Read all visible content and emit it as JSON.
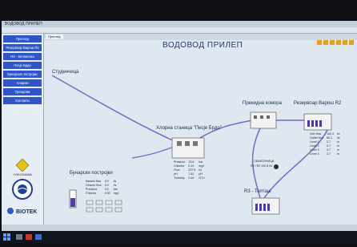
{
  "window": {
    "title": "ВОДОВОД ПРИЛЕП"
  },
  "sidebar": {
    "items": [
      {
        "label": "Преглед"
      },
      {
        "label": "Резервоар Варош R2"
      },
      {
        "label": "R3 - Ѕелѕенска"
      },
      {
        "label": "Песје Брдо"
      },
      {
        "label": "Бунарски постројки"
      },
      {
        "label": "Аларми"
      },
      {
        "label": "Трендови"
      },
      {
        "label": "Контакти"
      }
    ],
    "logos": {
      "yokogawa": "YOKOGAWA",
      "biotek": "BIOTEK"
    }
  },
  "main": {
    "tab_label": "Преглед",
    "title": "ВОДОВОД ПРИЛЕП",
    "nodes": {
      "studenchica": "Студенчица",
      "chlorine_station": "Хлорна станица \"Песје Брдо\"",
      "prekidna": "Прекидна комора",
      "rezervoar_r2": "Резервоар Варош R2",
      "r3": "R3 - Топташ",
      "bunarski": "Бунарски постројки",
      "obikolnica": "ОБИКОЛНИЦА",
      "obikolnica_val": "R3 +R2    100.8  l/s"
    },
    "chlorine_table": [
      [
        "Pressure",
        "13.6",
        "bar"
      ],
      [
        "Chlorine",
        "0.14",
        "mg/l"
      ],
      [
        "Flow",
        "237.6",
        "l/s"
      ],
      [
        "pH",
        "7.61",
        "pH"
      ],
      [
        "Turbidity",
        "0.60",
        "NTU"
      ]
    ],
    "bunar_table": [
      [
        "Каналк.flow",
        "0.0",
        "l/s"
      ],
      [
        "Отвоно flow",
        "0.0",
        "l/s"
      ],
      [
        "Pressure",
        "0.0",
        "bar"
      ],
      [
        "Chlorine",
        "0.00",
        "mg/l"
      ]
    ],
    "r2_table": [
      [
        "Inlet flow",
        "102.4",
        "l/s"
      ],
      [
        "Outlet flow",
        "80.1",
        "l/s"
      ],
      [
        "Level 1",
        "3.7",
        "m"
      ],
      [
        "Level 2",
        "3.7",
        "m"
      ],
      [
        "Level 3",
        "3.7",
        "m"
      ],
      [
        "Level 4",
        "3.7",
        "m"
      ]
    ]
  },
  "colors": {
    "accent": "#2f56c9",
    "pipe": "#7b68c9",
    "pipe_green": "#4c9a54",
    "bg": "#dfe8f1"
  }
}
